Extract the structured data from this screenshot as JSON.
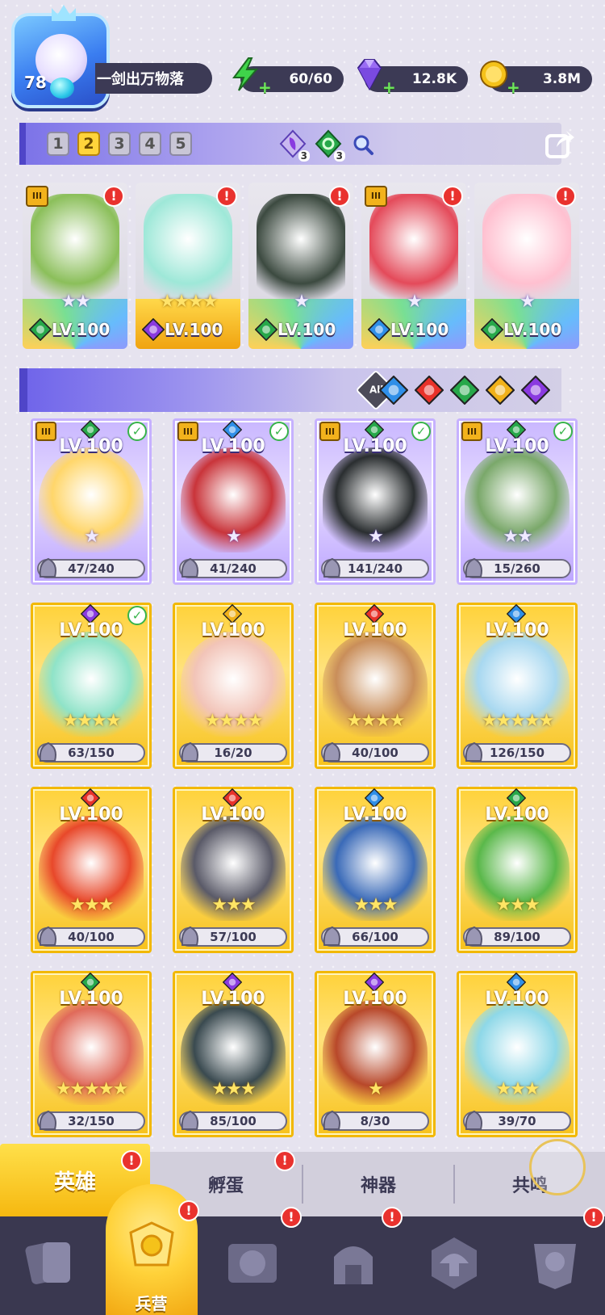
{
  "player": {
    "level": "78",
    "name": "一剑出万物落"
  },
  "resources": [
    {
      "icon": "energy-icon",
      "value": "60/60",
      "color": "#3fd44a"
    },
    {
      "icon": "gem-icon",
      "value": "12.8K",
      "color": "#8a5cf0"
    },
    {
      "icon": "coin-icon",
      "value": "3.8M",
      "color": "#f5c21a"
    }
  ],
  "team_bar": {
    "slots": [
      "1",
      "2",
      "3",
      "4",
      "5"
    ],
    "active_slot": "2",
    "element_counts": [
      {
        "icon": "dark-element-icon",
        "count": "3"
      },
      {
        "icon": "nature-element-icon",
        "count": "3"
      }
    ]
  },
  "team_cards": [
    {
      "level": "LV.100",
      "element": "nature",
      "stars": "★★",
      "rank": "III",
      "alert": "!",
      "art": "#8bbf5a"
    },
    {
      "level": "LV.100",
      "element": "dark",
      "stars": "★★★★",
      "rank": "",
      "alert": "!",
      "art": "#9ee8d8",
      "gold": true
    },
    {
      "level": "LV.100",
      "element": "nature",
      "stars": "★",
      "rank": "",
      "alert": "!",
      "art": "#3c4a40"
    },
    {
      "level": "LV.100",
      "element": "water",
      "stars": "★",
      "rank": "III",
      "alert": "!",
      "art": "#e44a5a"
    },
    {
      "level": "LV.100",
      "element": "nature",
      "stars": "★",
      "rank": "",
      "alert": "!",
      "art": "#ffc0d0"
    }
  ],
  "filter": {
    "all_label": "All",
    "elements": [
      "water",
      "fire",
      "nature",
      "light",
      "dark"
    ]
  },
  "colors": {
    "water": "#2f8fe8",
    "fire": "#e8322a",
    "nature": "#27a84a",
    "light": "#f0b11a",
    "dark": "#8a3ae0"
  },
  "heroes": [
    {
      "level": "LV.100",
      "element": "nature",
      "stars": "★",
      "shards": "47/240",
      "tier": "purple",
      "rank": "III",
      "check": true,
      "art": "#ffd66a"
    },
    {
      "level": "LV.100",
      "element": "water",
      "stars": "★",
      "shards": "41/240",
      "tier": "purple",
      "rank": "III",
      "check": true,
      "art": "#c9343a"
    },
    {
      "level": "LV.100",
      "element": "nature",
      "stars": "★",
      "shards": "141/240",
      "tier": "purple",
      "rank": "III",
      "check": true,
      "art": "#2a2e30"
    },
    {
      "level": "LV.100",
      "element": "nature",
      "stars": "★★",
      "shards": "15/260",
      "tier": "purple",
      "rank": "III",
      "check": true,
      "art": "#7aa86a"
    },
    {
      "level": "LV.100",
      "element": "dark",
      "stars": "★★★★",
      "shards": "63/150",
      "tier": "gold",
      "rank": "",
      "check": true,
      "art": "#8fe3c8"
    },
    {
      "level": "LV.100",
      "element": "light",
      "stars": "★★★★",
      "shards": "16/20",
      "tier": "gold",
      "rank": "",
      "check": false,
      "art": "#f2c4b8"
    },
    {
      "level": "LV.100",
      "element": "fire",
      "stars": "★★★★",
      "shards": "40/100",
      "tier": "gold",
      "rank": "",
      "check": false,
      "art": "#c98e5a"
    },
    {
      "level": "LV.100",
      "element": "water",
      "stars": "★★★★★",
      "shards": "126/150",
      "tier": "gold",
      "rank": "",
      "check": false,
      "art": "#a8d8f0"
    },
    {
      "level": "LV.100",
      "element": "fire",
      "stars": "★★★",
      "shards": "40/100",
      "tier": "gold",
      "rank": "",
      "check": false,
      "art": "#e8482a"
    },
    {
      "level": "LV.100",
      "element": "fire",
      "stars": "★★★",
      "shards": "57/100",
      "tier": "gold",
      "rank": "",
      "check": false,
      "art": "#5a5a68"
    },
    {
      "level": "LV.100",
      "element": "water",
      "stars": "★★★",
      "shards": "66/100",
      "tier": "gold",
      "rank": "",
      "check": false,
      "art": "#3a6ab8"
    },
    {
      "level": "LV.100",
      "element": "nature",
      "stars": "★★★",
      "shards": "89/100",
      "tier": "gold",
      "rank": "",
      "check": false,
      "art": "#5ab84a"
    },
    {
      "level": "LV.100",
      "element": "nature",
      "stars": "★★★★★",
      "shards": "32/150",
      "tier": "gold",
      "rank": "",
      "check": false,
      "art": "#e06a5a"
    },
    {
      "level": "LV.100",
      "element": "dark",
      "stars": "★★★",
      "shards": "85/100",
      "tier": "gold",
      "rank": "",
      "check": false,
      "art": "#3a4a50"
    },
    {
      "level": "LV.100",
      "element": "dark",
      "stars": "★",
      "shards": "8/30",
      "tier": "gold",
      "rank": "",
      "check": false,
      "art": "#b8482a"
    },
    {
      "level": "LV.100",
      "element": "water",
      "stars": "★★★",
      "shards": "39/70",
      "tier": "gold",
      "rank": "",
      "check": false,
      "art": "#8ed8e8"
    }
  ],
  "subtabs": [
    {
      "label": "英雄",
      "active": true,
      "alert": "!"
    },
    {
      "label": "孵蛋",
      "active": false,
      "alert": "!"
    },
    {
      "label": "神器",
      "active": false,
      "alert": ""
    },
    {
      "label": "共鸣",
      "active": false,
      "alert": ""
    }
  ],
  "nav": [
    {
      "icon": "cards-icon",
      "label": "",
      "alert": ""
    },
    {
      "icon": "barracks-icon",
      "label": "兵营",
      "alert": "!",
      "active": true
    },
    {
      "icon": "map-icon",
      "label": "",
      "alert": "!"
    },
    {
      "icon": "castle-icon",
      "label": "",
      "alert": "!"
    },
    {
      "icon": "mushroom-icon",
      "label": "",
      "alert": ""
    },
    {
      "icon": "guild-icon",
      "label": "",
      "alert": "!"
    }
  ]
}
